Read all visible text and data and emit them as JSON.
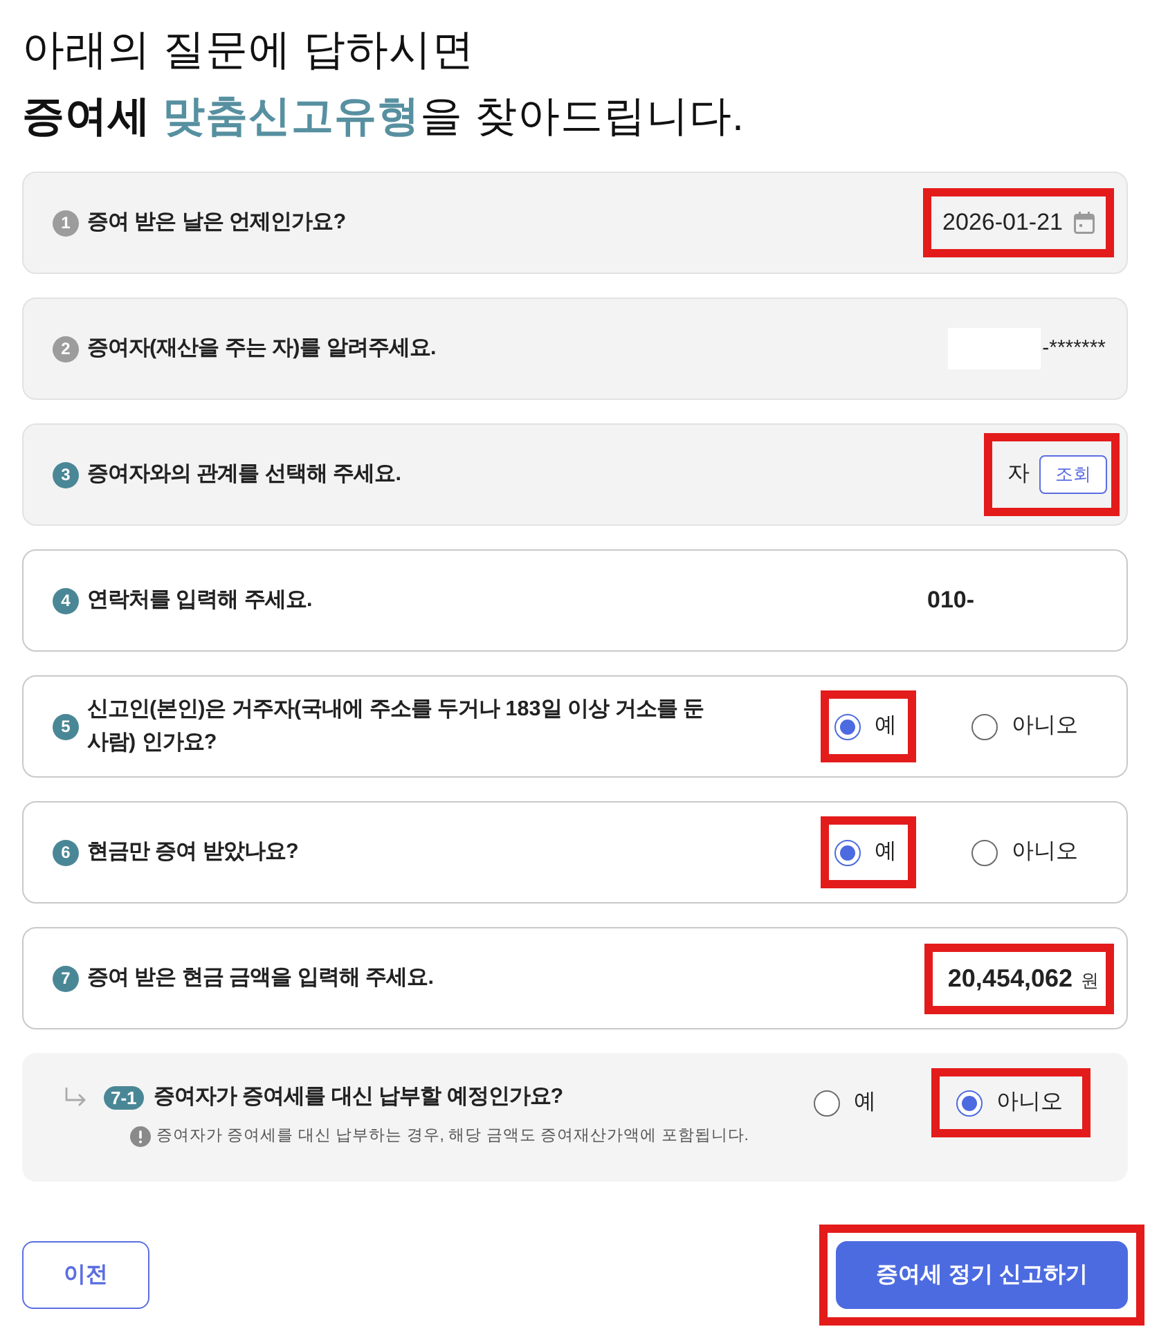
{
  "heading": {
    "line_1": "아래의 질문에 답하시면",
    "line_2": {
      "emphasis": "증여세",
      "accent": "맞춤신고유형",
      "rest": "을 찾아드립니다."
    }
  },
  "questions": [
    {
      "number": "1",
      "text": "증여 받은 날은 언제인가요?",
      "readonly": true,
      "badge_dimmed": true,
      "answer": {
        "kind": "date",
        "value": "2026-01-21",
        "highlighted": true
      }
    },
    {
      "number": "2",
      "text": "증여자(재산을 주는 자)를 알려주세요.",
      "readonly": true,
      "badge_dimmed": true,
      "answer": {
        "kind": "masked",
        "value": "-*******",
        "highlighted": false
      }
    },
    {
      "number": "3",
      "text": "증여자와의 관계를 선택해 주세요.",
      "readonly": true,
      "badge_dimmed": false,
      "answer": {
        "kind": "lookup",
        "value": "자",
        "button": "조회",
        "highlighted": true
      }
    },
    {
      "number": "4",
      "text": "연락처를 입력해 주세요.",
      "readonly": false,
      "badge_dimmed": false,
      "answer": {
        "kind": "text",
        "value": "010-",
        "highlighted": false
      }
    },
    {
      "number": "5",
      "text": "신고인(본인)은 거주자(국내에 주소를 두거나 183일 이상 거소를 둔 사람) 인가요?",
      "readonly": false,
      "badge_dimmed": false,
      "answer": {
        "kind": "choice",
        "options": [
          {
            "label": "예",
            "selected": true,
            "highlighted": true
          },
          {
            "label": "아니오",
            "selected": false,
            "highlighted": false
          }
        ]
      }
    },
    {
      "number": "6",
      "text": "현금만 증여 받았나요?",
      "readonly": false,
      "badge_dimmed": false,
      "answer": {
        "kind": "choice",
        "options": [
          {
            "label": "예",
            "selected": true,
            "highlighted": true
          },
          {
            "label": "아니오",
            "selected": false,
            "highlighted": false
          }
        ]
      }
    },
    {
      "number": "7",
      "text": "증여 받은 현금 금액을 입력해 주세요.",
      "readonly": false,
      "badge_dimmed": false,
      "answer": {
        "kind": "amount",
        "value": "20,454,062",
        "unit": "원",
        "highlighted": true
      }
    }
  ],
  "sub_question": {
    "number": "7-1",
    "text": "증여자가 증여세를 대신 납부할 예정인가요?",
    "note": "증여자가 증여세를 대신 납부하는 경우, 해당 금액도 증여재산가액에 포함됩니다.",
    "options": [
      {
        "label": "예",
        "selected": false,
        "highlighted": false
      },
      {
        "label": "아니오",
        "selected": true,
        "highlighted": true
      }
    ]
  },
  "buttons": [
    {
      "kind": "secondary",
      "label": "이전",
      "highlighted": false
    },
    {
      "kind": "primary",
      "label": "증여세 정기 신고하기",
      "highlighted": true
    }
  ]
}
